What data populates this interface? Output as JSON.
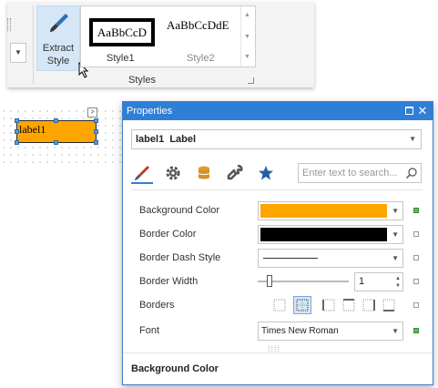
{
  "ribbon": {
    "extract_label_line1": "Extract",
    "extract_label_line2": "Style",
    "gallery": {
      "style1_preview": "AaBbCcD",
      "style2_preview": "AaBbCcDdE",
      "style1_name": "Style1",
      "style2_name": "Style2"
    },
    "group_label": "Styles"
  },
  "design_surface": {
    "label_text": "label1",
    "label_background": "#ffa500"
  },
  "properties": {
    "title": "Properties",
    "selected_object_name": "label1",
    "selected_object_type": "Label",
    "tabs": [
      "appearance",
      "behavior",
      "data",
      "actions",
      "favorites"
    ],
    "search_placeholder": "Enter text to search...",
    "rows": {
      "background_color": {
        "label": "Background Color",
        "value": "#ffa500"
      },
      "border_color": {
        "label": "Border Color",
        "value": "#000000"
      },
      "border_dash_style": {
        "label": "Border Dash Style",
        "value": "solid"
      },
      "border_width": {
        "label": "Border Width",
        "value": "1"
      },
      "borders": {
        "label": "Borders",
        "selected": "all"
      },
      "font": {
        "label": "Font",
        "value": "Times New Roman"
      }
    },
    "description_title": "Background Color"
  },
  "colors": {
    "accent": "#2f7fd6",
    "orange": "#ffa500",
    "modified_marker": "#5fb85f"
  }
}
